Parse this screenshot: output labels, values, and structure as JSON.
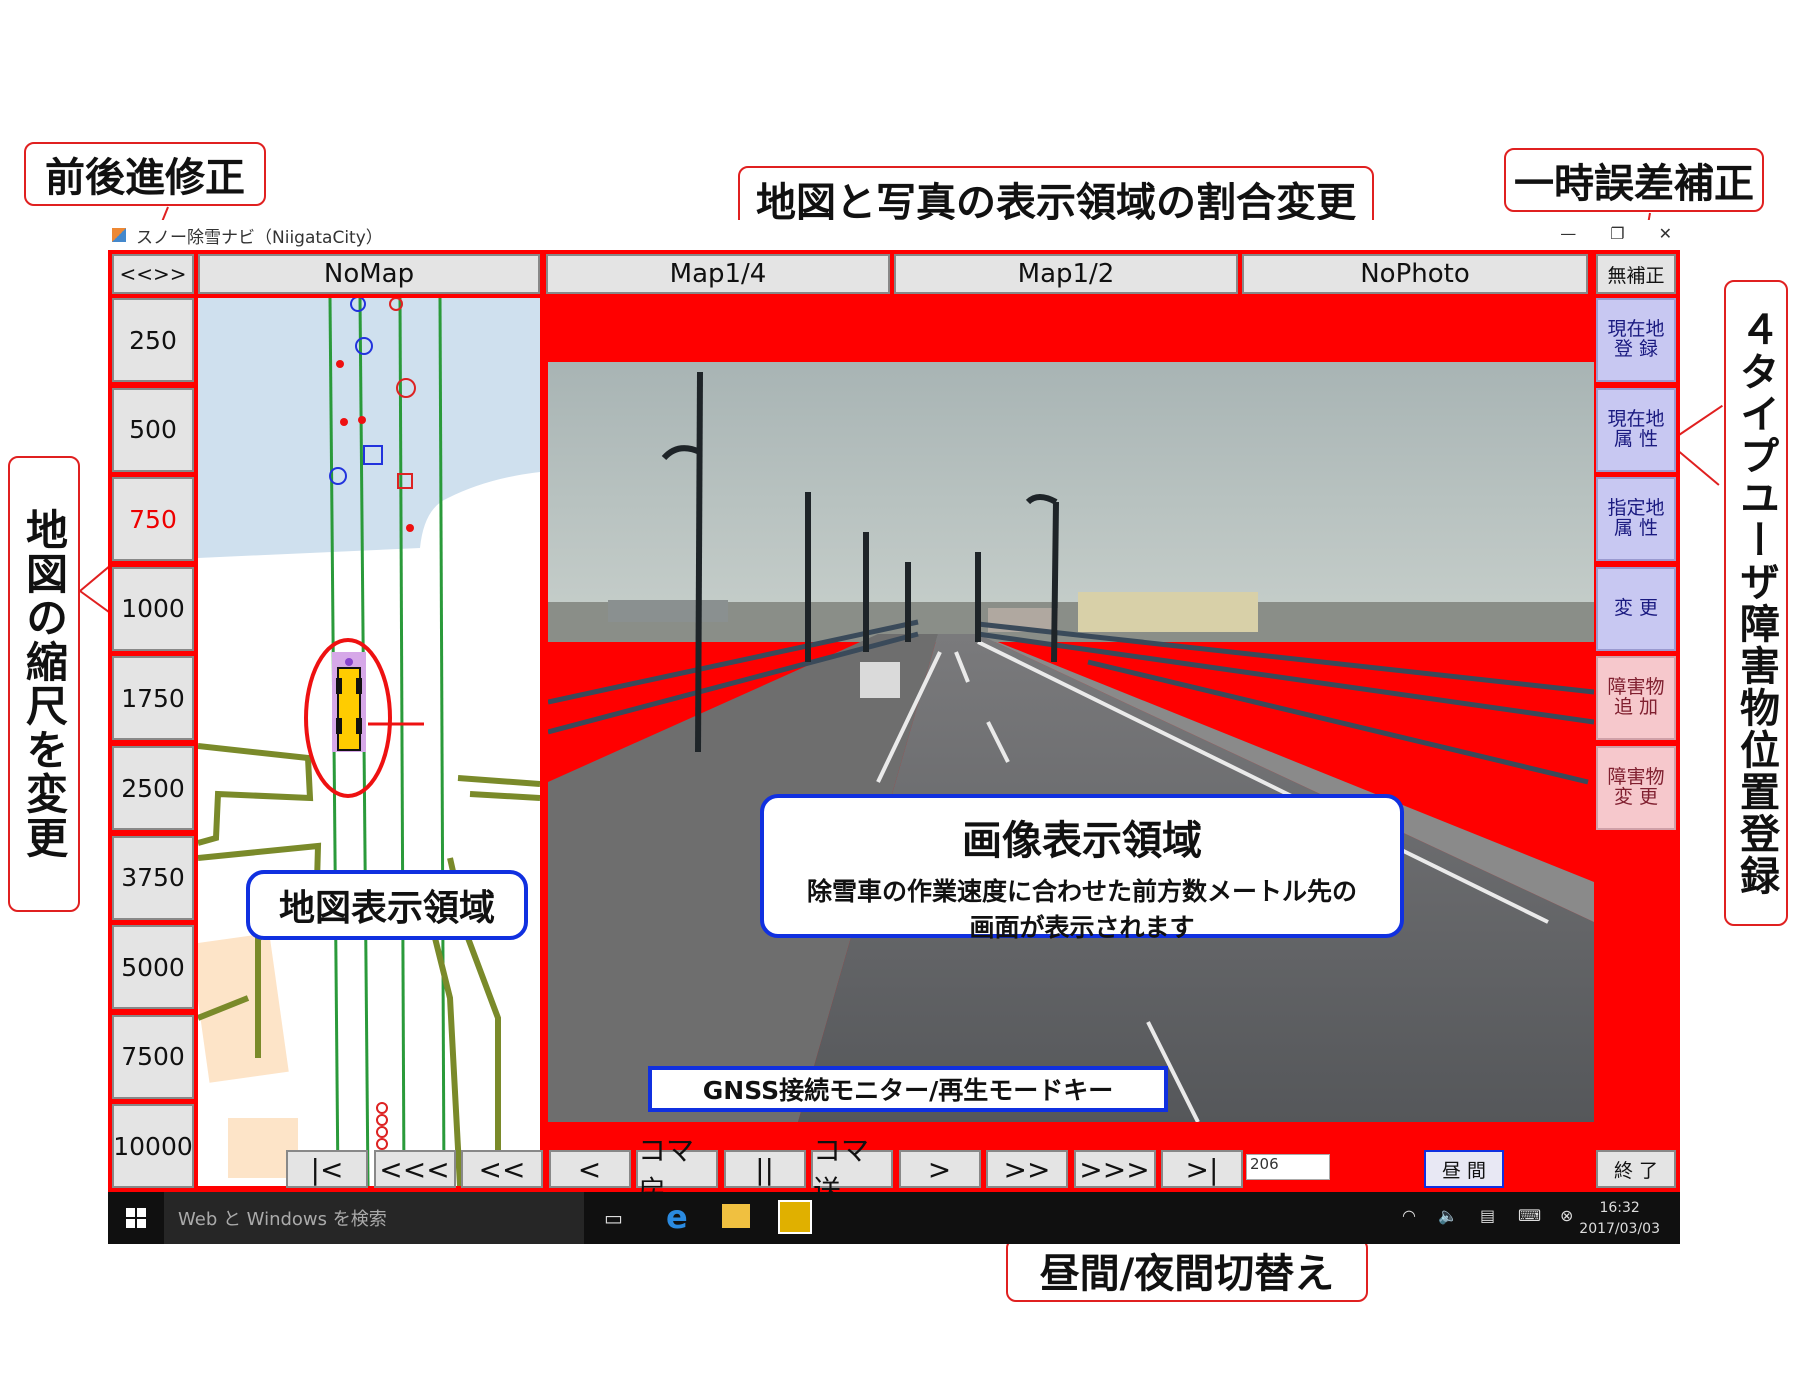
{
  "callouts": {
    "seek_adjust": "前後進修正",
    "ratio_change": "地図と写真の表示領域の割合変更",
    "temp_correction": "一時誤差補正",
    "map_scale_change": "地図の縮尺を変更",
    "obstacle_register": "４タイプユーザ障害物位置登録",
    "day_night": "昼間/夜間切替え"
  },
  "window": {
    "title": "スノー除雪ナビ（NiigataCity）",
    "minimize": "—",
    "restore": "❐",
    "close": "✕"
  },
  "top_buttons": {
    "seek": "<<>>",
    "no_map": "NoMap",
    "map_quarter": "Map1/4",
    "map_half": "Map1/2",
    "no_photo": "NoPhoto",
    "no_correction": "無補正"
  },
  "scales": [
    "250",
    "500",
    "750",
    "1000",
    "1750",
    "2500",
    "3750",
    "5000",
    "7500",
    "10000"
  ],
  "active_scale": "750",
  "side_buttons": [
    {
      "label": "現在地 登 録",
      "tone": "blue"
    },
    {
      "label": "現在地 属 性",
      "tone": "blue"
    },
    {
      "label": "指定地 属 性",
      "tone": "blue"
    },
    {
      "label": "変 更",
      "tone": "blue"
    },
    {
      "label": "障害物 追 加",
      "tone": "pink"
    },
    {
      "label": "障害物 変 更",
      "tone": "pink"
    }
  ],
  "nav_buttons": [
    "|<",
    "<<<",
    "<<",
    "<",
    "コマ戻",
    "||",
    "コマ送",
    ">",
    ">>",
    ">>>",
    ">|"
  ],
  "frame_counter": "206",
  "day_night_button": "昼 間",
  "exit_button": "終 了",
  "map_area_label": "地図表示領域",
  "image_area": {
    "title": "画像表示領域",
    "desc_line1": "除雪車の作業速度に合わせた前方数メートル先の",
    "desc_line2": "画面が表示されます"
  },
  "gnss_label": "GNSS接続モニター/再生モードキー",
  "taskbar": {
    "search_placeholder": "Web と Windows を検索",
    "time": "16:32",
    "date": "2017/03/03"
  },
  "colors": {
    "frame_red": "#ff0000",
    "callout_border": "#e02020",
    "overlay_border": "#1030e0",
    "side_blue": "#c8c8f2",
    "side_pink": "#f6c8cc"
  }
}
